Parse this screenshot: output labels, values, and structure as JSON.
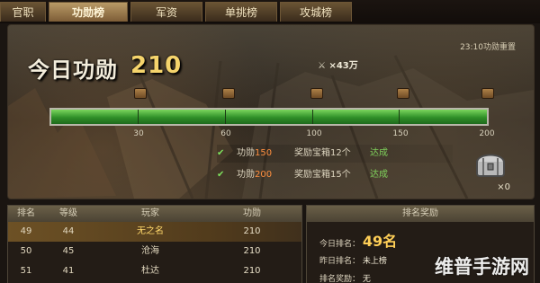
{
  "tabs": [
    "官职",
    "功勋榜",
    "军资",
    "单挑榜",
    "攻城榜"
  ],
  "top_panel": {
    "reset_time_label": "23:10功勋重置",
    "today_merit_label": "今日功勋",
    "today_merit_value": "210",
    "bonus_label": "×43万"
  },
  "progress": {
    "current": 210,
    "max": 200,
    "ticks": [
      "30",
      "60",
      "100",
      "150",
      "200"
    ]
  },
  "rewards": [
    {
      "check": "✔",
      "label_prefix": "功勋",
      "label_value": "150",
      "detail": "奖励宝箱12个",
      "status": "达成"
    },
    {
      "check": "✔",
      "label_prefix": "功勋",
      "label_value": "200",
      "detail": "奖励宝箱15个",
      "status": "达成"
    }
  ],
  "chest_count": "×0",
  "table": {
    "headers": [
      "排名",
      "等级",
      "玩家",
      "功勋"
    ],
    "rows": [
      [
        "49",
        "44",
        "无之名",
        "210"
      ],
      [
        "50",
        "45",
        "沧海",
        "210"
      ],
      [
        "51",
        "41",
        "杜达",
        "210"
      ]
    ]
  },
  "rank_panel": {
    "title": "排名奖励",
    "today_label": "今日排名：",
    "today_value": "49名",
    "yesterday_label": "昨日排名：",
    "yesterday_value": "未上榜",
    "reward_label": "排名奖励：",
    "reward_value": "无"
  },
  "watermark": "维普手游网",
  "colors": {
    "tab_active": "#b99a66",
    "progress_green": "#2f8f28",
    "highlight_row": "#6d5125",
    "rank_gold": "#ffcf57",
    "status_green": "#7fd05b"
  }
}
